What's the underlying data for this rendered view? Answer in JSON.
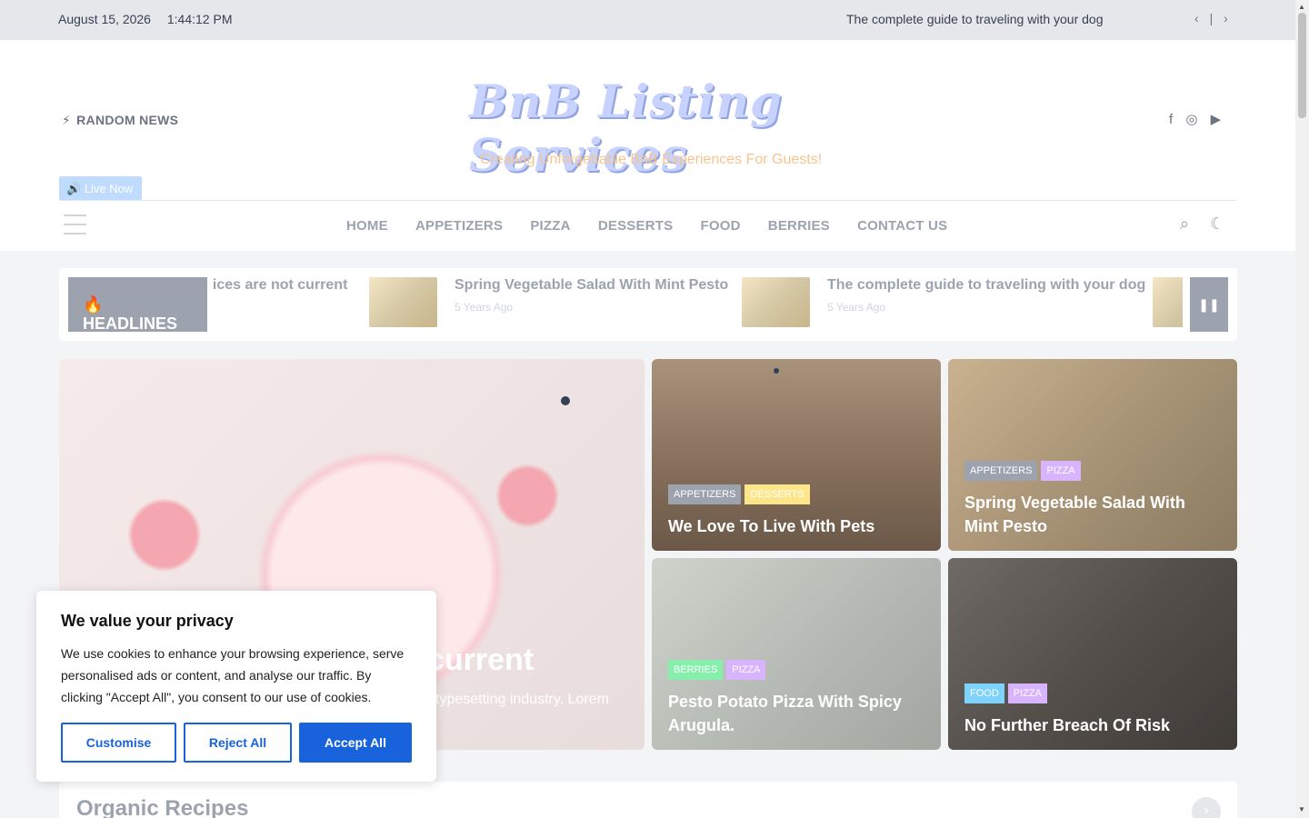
{
  "topbar": {
    "date": "August 15, 2026",
    "time": "1:44:12 PM",
    "ticker": "The complete guide to traveling with your dog"
  },
  "header": {
    "random_news": "RANDOM NEWS",
    "logo": "BnB Listing Services",
    "tagline": "Creating Unforgettable BnB Experiences For Guests!",
    "live_now": "Live Now",
    "socials": [
      "facebook-icon",
      "instagram-icon",
      "youtube-icon"
    ]
  },
  "nav": {
    "items": [
      "HOME",
      "APPETIZERS",
      "PIZZA",
      "DESSERTS",
      "FOOD",
      "BERRIES",
      "CONTACT US"
    ]
  },
  "headlines": {
    "label": "HEADLINES",
    "items": [
      {
        "title": "vices are not current",
        "time": ""
      },
      {
        "title": "Spring Vegetable Salad With Mint Pesto",
        "time": "5 Years Ago"
      },
      {
        "title": "The complete guide to traveling with your dog",
        "time": "5 Years Ago"
      }
    ]
  },
  "hero": {
    "big_title": "current",
    "big_excerpt": "typesetting industry. Lorem",
    "cards": [
      {
        "cats": [
          "APPETIZERS",
          "DESSERTS"
        ],
        "title": "We Love To Live With Pets"
      },
      {
        "cats": [
          "APPETIZERS",
          "PIZZA"
        ],
        "title": "Spring Vegetable Salad With Mint Pesto"
      },
      {
        "cats": [
          "BERRIES",
          "PIZZA"
        ],
        "title": "Pesto Potato Pizza With Spicy Arugula."
      },
      {
        "cats": [
          "FOOD",
          "PIZZA"
        ],
        "title": "No Further Breach Of Risk"
      }
    ]
  },
  "organic": {
    "title": "Organic Recipes"
  },
  "cookie": {
    "title": "We value your privacy",
    "text": "We use cookies to enhance your browsing experience, serve personalised ads or content, and analyse our traffic. By clicking \"Accept All\", you consent to our use of cookies.",
    "customise": "Customise",
    "reject": "Reject All",
    "accept": "Accept All"
  },
  "colors": {
    "accent": "#1863dc",
    "cat_appetizers": "#9ca3af",
    "cat_desserts": "#fde68a",
    "cat_pizza": "#d8b4fe",
    "cat_berries": "#86efac",
    "cat_food": "#7dd3fc"
  }
}
